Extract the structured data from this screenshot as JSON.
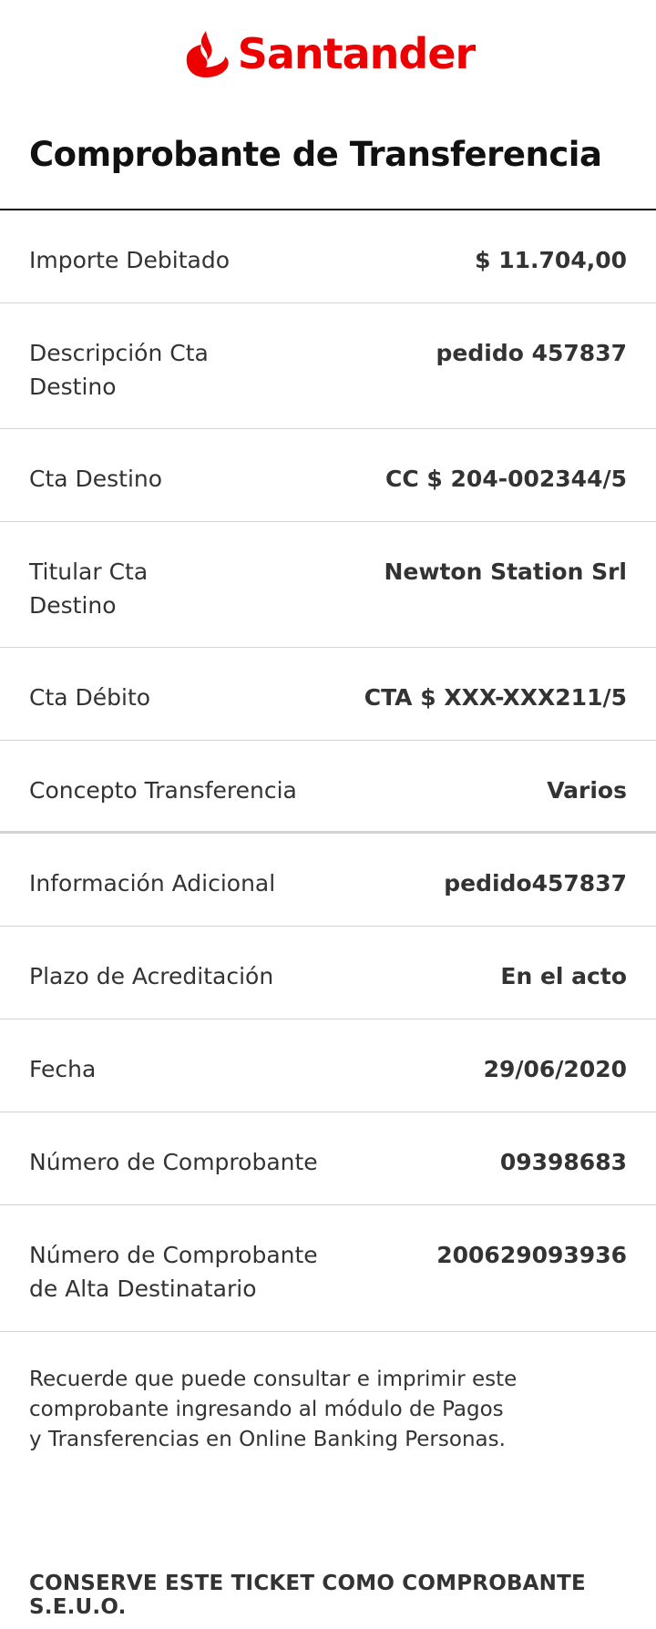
{
  "brand": {
    "name": "Santander",
    "color": "#ec0000",
    "icon": "santander-flame-logo"
  },
  "title": "Comprobante de Transferencia",
  "rows": [
    {
      "label": "Importe Debitado",
      "value": "$ 11.704,00"
    },
    {
      "label": "Descripción Cta Destino",
      "value": "pedido 457837"
    },
    {
      "label": "Cta Destino",
      "value": "CC $ 204-002344/5"
    },
    {
      "label": "Titular Cta Destino",
      "value": "Newton Station Srl"
    },
    {
      "label": "Cta Débito",
      "value": "CTA $ XXX-XXX211/5"
    },
    {
      "label": "Concepto Transferencia",
      "value": "Varios"
    },
    {
      "label": "Información Adicional",
      "value": "pedido457837"
    },
    {
      "label": "Plazo de Acreditación",
      "value": "En el acto"
    },
    {
      "label": "Fecha",
      "value": "29/06/2020"
    },
    {
      "label": "Número de Comprobante",
      "value": "09398683"
    },
    {
      "label": "Número de Comprobante de Alta Destinatario",
      "value": "200629093936"
    }
  ],
  "note": "Recuerde que puede consultar e imprimir este comprobante ingresando al módulo de Pagos y Transferencias en Online Banking Personas.",
  "footer": "CONSERVE ESTE TICKET COMO COMPROBANTE S.E.U.O."
}
